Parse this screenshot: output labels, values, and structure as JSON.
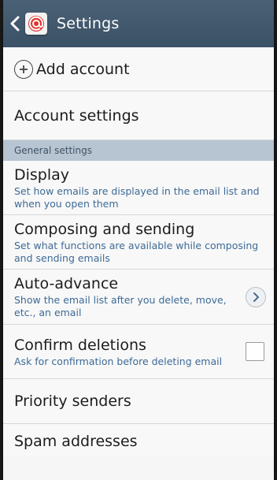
{
  "appbar": {
    "title": "Settings",
    "back_icon": "chevron-left-icon",
    "app_icon": "email-app-icon",
    "colors": {
      "bar": "#3b5166",
      "accent": "#3d6a96"
    }
  },
  "add_account": {
    "label": "Add account",
    "icon": "plus-circle-icon"
  },
  "account_settings": {
    "label": "Account settings"
  },
  "general_header": "General settings",
  "display": {
    "title": "Display",
    "subtitle": "Set how emails are displayed in the email list and when you open them"
  },
  "composing": {
    "title": "Composing and sending",
    "subtitle": "Set what functions are available while composing and sending emails"
  },
  "auto_advance": {
    "title": "Auto-advance",
    "subtitle": "Show the email list after you delete, move, etc., an email",
    "icon": "chevron-right-icon"
  },
  "confirm_deletions": {
    "title": "Confirm deletions",
    "subtitle": "Ask for confirmation before deleting email",
    "checked": false
  },
  "priority_senders": {
    "title": "Priority senders"
  },
  "spam_addresses": {
    "title": "Spam addresses"
  }
}
